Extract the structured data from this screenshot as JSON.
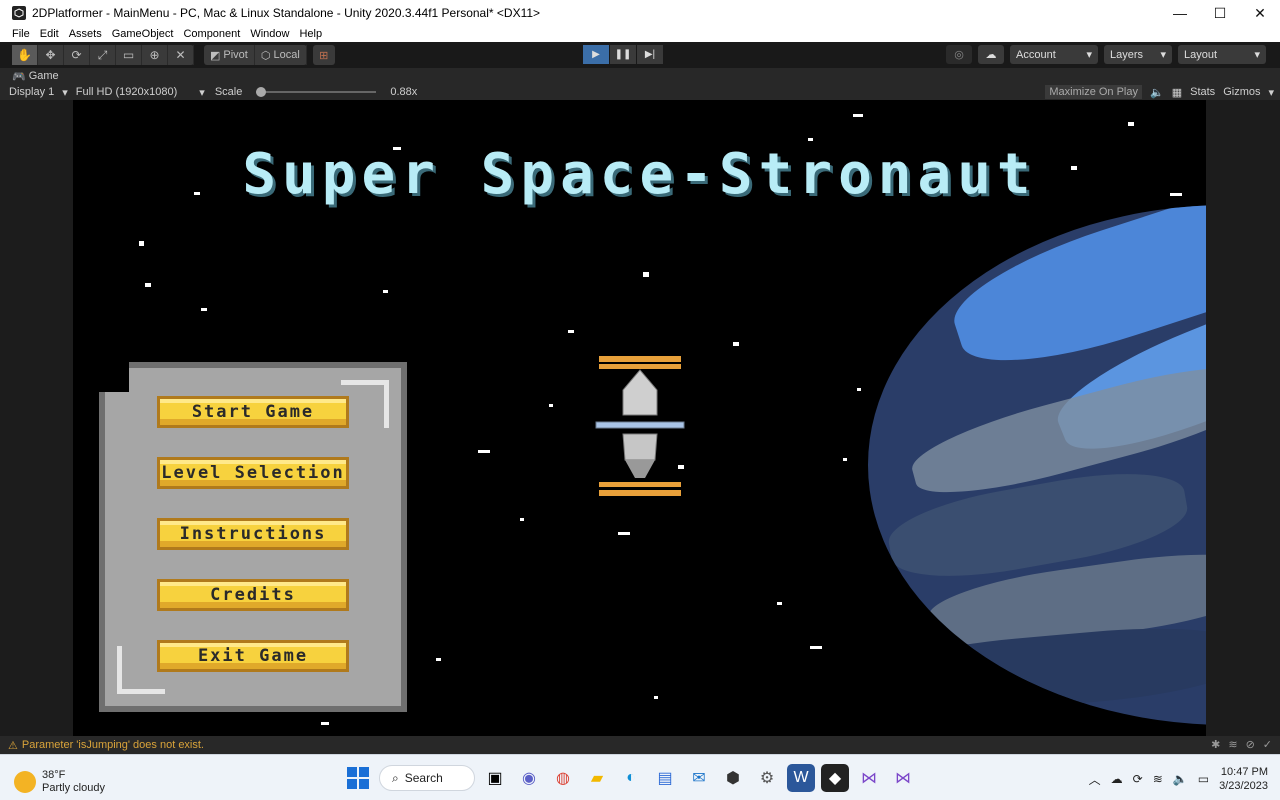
{
  "window": {
    "title": "2DPlatformer - MainMenu - PC, Mac & Linux Standalone - Unity 2020.3.44f1 Personal* <DX11>",
    "minimize": "—",
    "maximize": "☐",
    "close": "✕"
  },
  "menubar": {
    "items": [
      "File",
      "Edit",
      "Assets",
      "GameObject",
      "Component",
      "Window",
      "Help"
    ]
  },
  "toolbar": {
    "pivot_label": "Pivot",
    "local_label": "Local",
    "account_label": "Account",
    "layers_label": "Layers",
    "layout_label": "Layout",
    "play_color": "#3b6ea8"
  },
  "game_tab": {
    "label": "Game"
  },
  "game_bar": {
    "display": "Display 1",
    "resolution": "Full HD (1920x1080)",
    "scale_label": "Scale",
    "scale_value": "0.88x",
    "maximize_on_play": "Maximize On Play",
    "stats": "Stats",
    "gizmos": "Gizmos"
  },
  "game": {
    "title": "Super Space-Stronaut",
    "title_color": "#b8ecf6",
    "buttons": {
      "start": "Start Game",
      "level": "Level Selection",
      "instructions": "Instructions",
      "credits": "Credits",
      "exit": "Exit Game"
    },
    "button_color": "#f7d23e"
  },
  "status": {
    "message": "Parameter 'isJumping' does not exist."
  },
  "taskbar": {
    "weather_temp": "38°F",
    "weather_desc": "Partly cloudy",
    "search_label": "Search",
    "time": "10:47 PM",
    "date": "3/23/2023"
  }
}
